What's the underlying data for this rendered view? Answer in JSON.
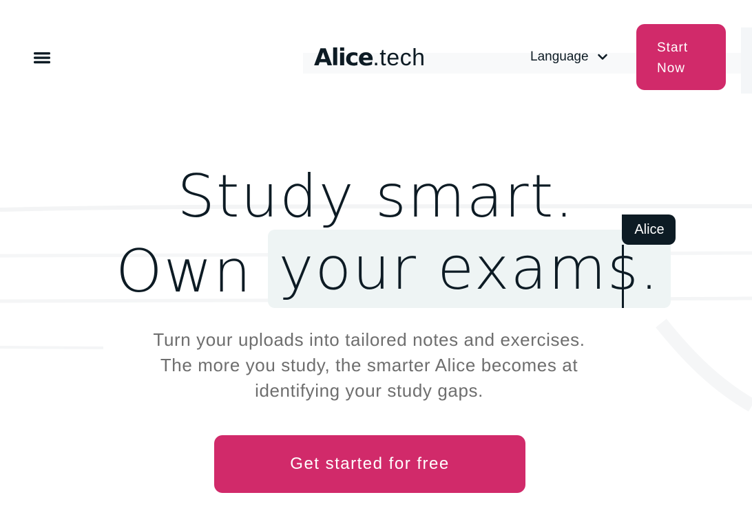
{
  "header": {
    "menu_icon": "hamburger-menu-icon",
    "logo": {
      "bold": "Alice",
      "light": ".tech"
    },
    "language": {
      "label": "Language",
      "icon": "chevron-down-icon"
    },
    "start_button": {
      "line1": "Start",
      "line2": "Now"
    }
  },
  "hero": {
    "headline_line1": "Study smart.",
    "headline_line2_start": "Own",
    "headline_line2_highlight": "your exams.",
    "cursor_tag": "Alice",
    "subtext_lines": [
      "Turn your uploads into tailored notes and exercises.",
      "The more you study, the smarter Alice becomes at",
      "identifying your study gaps."
    ],
    "cta_label": "Get started for free"
  },
  "colors": {
    "accent": "#d12a6a",
    "text_dark": "#0d1b24",
    "highlight_bg": "#eef4f4",
    "subtext": "#6e6e6e"
  }
}
